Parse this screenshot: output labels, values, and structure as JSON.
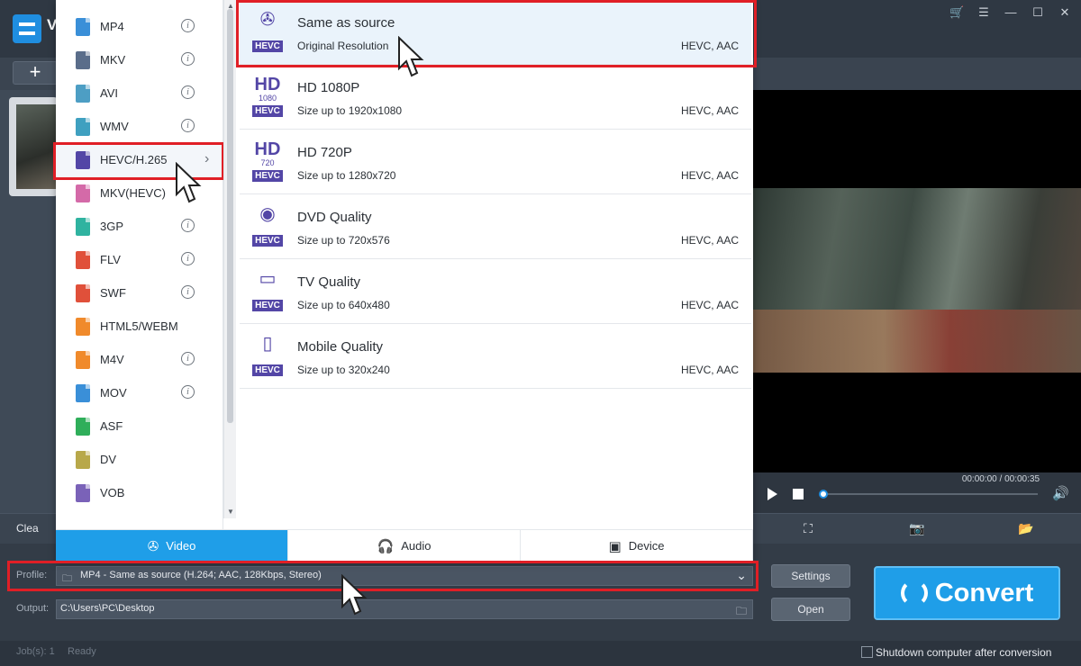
{
  "app": {
    "title_fragment": "V"
  },
  "window_controls": [
    "cart-icon",
    "menu-icon",
    "minimize-icon",
    "maximize-icon",
    "close-icon"
  ],
  "toolbar": {
    "add_label": "+",
    "clear_label": "Clea"
  },
  "formats": [
    {
      "name": "MP4",
      "color": "#3a8fd8",
      "info": true
    },
    {
      "name": "MKV",
      "color": "#5a6d8a",
      "info": true
    },
    {
      "name": "AVI",
      "color": "#4d9ec4",
      "info": true
    },
    {
      "name": "WMV",
      "color": "#3fa0c0",
      "info": true
    },
    {
      "name": "HEVC/H.265",
      "color": "#5346a6",
      "info": false,
      "selected": true
    },
    {
      "name": "MKV(HEVC)",
      "color": "#d46aa8",
      "info": false
    },
    {
      "name": "3GP",
      "color": "#2fb3a0",
      "info": true
    },
    {
      "name": "FLV",
      "color": "#e0503a",
      "info": true
    },
    {
      "name": "SWF",
      "color": "#e0503a",
      "info": true
    },
    {
      "name": "HTML5/WEBM",
      "color": "#f08a2b",
      "info": false
    },
    {
      "name": "M4V",
      "color": "#f08a2b",
      "info": true
    },
    {
      "name": "MOV",
      "color": "#3a8fd8",
      "info": true
    },
    {
      "name": "ASF",
      "color": "#2fae5a",
      "info": false
    },
    {
      "name": "DV",
      "color": "#b8a84a",
      "info": false
    },
    {
      "name": "VOB",
      "color": "#7a62b8",
      "info": false
    }
  ],
  "presets": [
    {
      "title": "Same as source",
      "sub": "Original Resolution",
      "codec": "HEVC, AAC",
      "glyph": "✇",
      "glyph_sub": "",
      "badge": "HEVC"
    },
    {
      "title": "HD 1080P",
      "sub": "Size up to 1920x1080",
      "codec": "HEVC, AAC",
      "glyph": "HD",
      "glyph_sub": "1080",
      "badge": "HEVC"
    },
    {
      "title": "HD 720P",
      "sub": "Size up to 1280x720",
      "codec": "HEVC, AAC",
      "glyph": "HD",
      "glyph_sub": "720",
      "badge": "HEVC"
    },
    {
      "title": "DVD Quality",
      "sub": "Size up to 720x576",
      "codec": "HEVC, AAC",
      "glyph": "◉",
      "glyph_sub": "",
      "badge": "HEVC"
    },
    {
      "title": "TV Quality",
      "sub": "Size up to 640x480",
      "codec": "HEVC, AAC",
      "glyph": "▭",
      "glyph_sub": "",
      "badge": "HEVC"
    },
    {
      "title": "Mobile Quality",
      "sub": "Size up to 320x240",
      "codec": "HEVC, AAC",
      "glyph": "▯",
      "glyph_sub": "",
      "badge": "HEVC"
    }
  ],
  "tabs": [
    {
      "label": "Video",
      "icon": "film-reel-icon",
      "glyph": "✇",
      "active": true
    },
    {
      "label": "Audio",
      "icon": "headphones-icon",
      "glyph": "🎧",
      "active": false
    },
    {
      "label": "Device",
      "icon": "device-icon",
      "glyph": "▣",
      "active": false
    }
  ],
  "player": {
    "time": "00:00:00 / 00:00:35",
    "progress": 0.0
  },
  "profile": {
    "label": "Profile:",
    "value": "MP4 - Same as source (H.264; AAC, 128Kbps, Stereo)"
  },
  "output": {
    "label": "Output:",
    "value": "C:\\Users\\PC\\Desktop"
  },
  "buttons": {
    "settings": "Settings",
    "open": "Open",
    "convert": "Convert"
  },
  "status": {
    "jobs": "Job(s): 1",
    "state": "Ready",
    "shutdown": "Shutdown computer after conversion"
  },
  "colors": {
    "accent": "#1f9ee8",
    "highlight": "#e01f26",
    "hevc": "#5346a6"
  }
}
